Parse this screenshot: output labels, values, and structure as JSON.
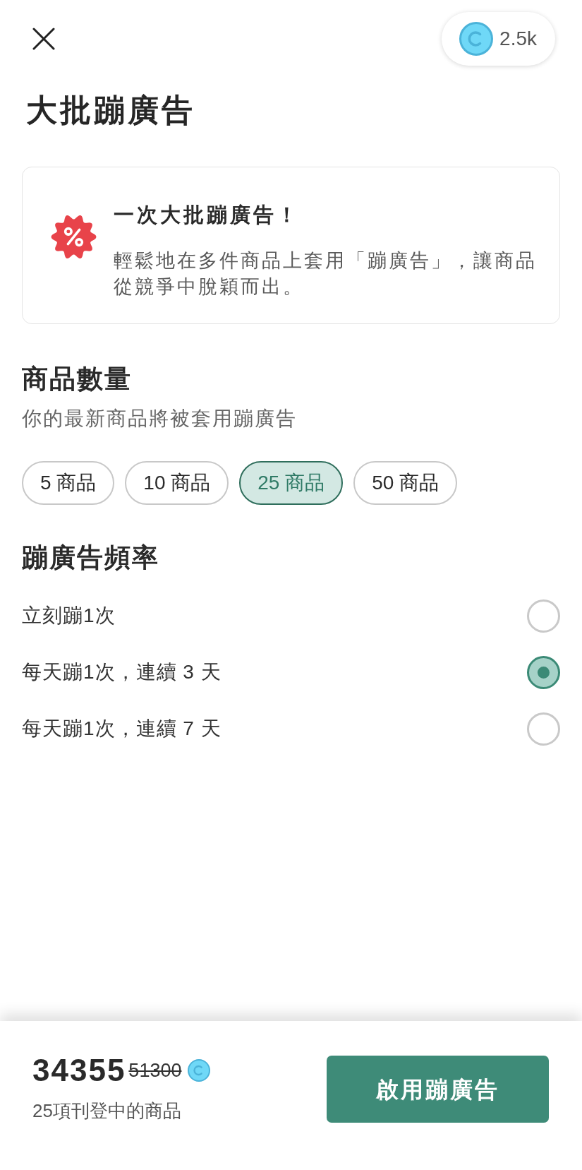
{
  "header": {
    "balance": "2.5k"
  },
  "title": "大批蹦廣告",
  "promo_card": {
    "title": "一次大批蹦廣告！",
    "description": "輕鬆地在多件商品上套用「蹦廣告」，讓商品從競爭中脫穎而出。"
  },
  "quantity": {
    "heading": "商品數量",
    "subtitle": "你的最新商品將被套用蹦廣告",
    "options": [
      {
        "label": "5 商品",
        "selected": false
      },
      {
        "label": "10 商品",
        "selected": false
      },
      {
        "label": "25 商品",
        "selected": true
      },
      {
        "label": "50 商品",
        "selected": false
      }
    ]
  },
  "frequency": {
    "heading": "蹦廣告頻率",
    "options": [
      {
        "label": "立刻蹦1次",
        "selected": false
      },
      {
        "label": "每天蹦1次，連續 3 天",
        "selected": true
      },
      {
        "label": "每天蹦1次，連續 7 天",
        "selected": false
      }
    ]
  },
  "footer": {
    "price": "34355",
    "original_price": "51300",
    "caption": "25項刊登中的商品",
    "button": "啟用蹦廣告"
  }
}
